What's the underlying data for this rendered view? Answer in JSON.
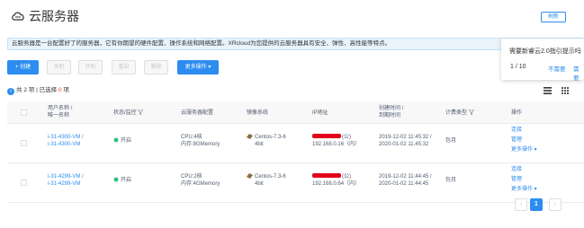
{
  "header": {
    "title": "云服务器",
    "refresh_label": "刷新"
  },
  "info_bar": {
    "text": "云服务器是一台配置好了的服务器，它有你期望的硬件配置、操作系统和网络配置。XRcloud为您提供的云服务器具有安全、弹性、高性能等特点。"
  },
  "toolbar": {
    "create": "+ 创建",
    "shutdown": "关机",
    "startup": "开机",
    "restart": "重启",
    "delete": "删除",
    "more_ops": "更多操作 ▾"
  },
  "summary": {
    "total_prefix": "共",
    "total": "2",
    "total_suffix": "项",
    "sep": "|",
    "selected_prefix": "已选择",
    "selected": "0",
    "selected_suffix": "项"
  },
  "table": {
    "headers": {
      "name_line1": "用户名称 /",
      "name_line2": "唯一名称",
      "status": "状态/监控",
      "config": "云服务器配置",
      "image": "镜像系统",
      "ip": "IP地址",
      "time_line1": "创建时间 /",
      "time_line2": "到期时间",
      "billing": "计费类型",
      "actions": "操作"
    },
    "rows": [
      {
        "name": "i-31-4300-VM /",
        "unique_name": "i-31-4300-VM",
        "status": "开启",
        "cpu": "CPU:4核",
        "memory": "内存:8GMemory",
        "os_line1": "Centos-7.3-6",
        "os_line2": "4bit",
        "public_ip_suffix": "(公)",
        "private_ip": "192.168.0.16（内）",
        "created": "2019-12-02 11:45:32 /",
        "expires": "2020-01-02 11:45:32",
        "billing": "包月",
        "action_connect": "连接",
        "action_manage": "管理",
        "action_more": "更多操作 ▾"
      },
      {
        "name": "i-31-4299-VM /",
        "unique_name": "i-31-4299-VM",
        "status": "开启",
        "cpu": "CPU:2核",
        "memory": "内存:4GMemory",
        "os_line1": "Centos-7.3-6",
        "os_line2": "4bit",
        "public_ip_suffix": "(公)",
        "private_ip": "192.168.0.64（内）",
        "created": "2019-12-02 11:44:45 /",
        "expires": "2020-01-02 11:44:45",
        "billing": "包月",
        "action_connect": "连接",
        "action_manage": "管理",
        "action_more": "更多操作 ▾"
      }
    ]
  },
  "pagination": {
    "prev": "‹",
    "current": "1",
    "next": "›"
  },
  "popover": {
    "text": "需要新睿云2.0指引提示吗",
    "counter": "1 / 10",
    "skip": "不需要",
    "next": "需要"
  },
  "colors": {
    "primary": "#2d8cf0",
    "status_on": "#19be6b",
    "redaction": "#e3001b",
    "info_bg": "#e8f3fc"
  },
  "icons": [
    "cloud-server-icon",
    "info-icon",
    "filter-icon",
    "linux-os-icon",
    "list-view-icon",
    "grid-view-icon"
  ]
}
